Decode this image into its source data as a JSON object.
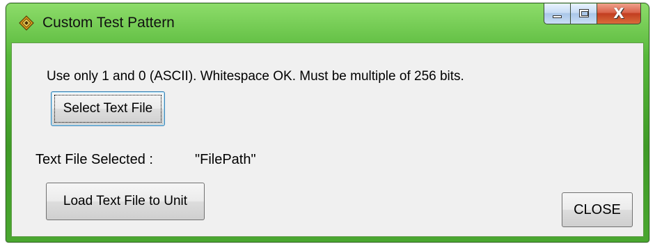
{
  "window": {
    "title": "Custom Test Pattern",
    "icon": "diamond-app-icon",
    "controls": {
      "minimize_icon": "minimize-icon",
      "maximize_icon": "maximize-icon",
      "close_glyph": "X"
    }
  },
  "content": {
    "instructions": "Use only 1 and 0 (ASCII).  Whitespace OK.  Must be multiple of 256 bits.",
    "select_button_label": "Select Text File",
    "selected_label": "Text File Selected :",
    "selected_path": "\"FilePath\"",
    "load_button_label": "Load Text File to Unit",
    "close_button_label": "CLOSE"
  },
  "colors": {
    "titlebar_green": "#57b83a",
    "client_background": "#f0f0f0",
    "close_button_red": "#c23d20",
    "focus_border_blue": "#3c7fb1"
  }
}
